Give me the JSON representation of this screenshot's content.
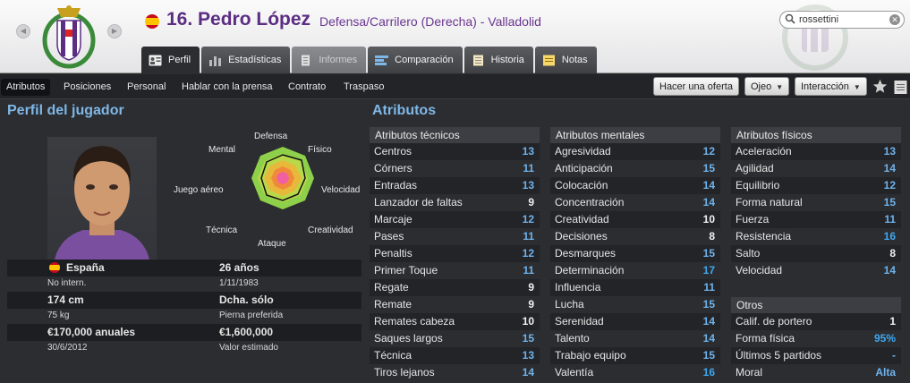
{
  "player": {
    "number_name": "16. Pedro López",
    "role_club": "Defensa/Carrilero (Derecha) - Valladolid"
  },
  "search": {
    "value": "rossettini"
  },
  "tabs": [
    {
      "label": "Perfil",
      "icon": "profile-card-icon",
      "active": true
    },
    {
      "label": "Estadísticas",
      "icon": "bar-chart-icon"
    },
    {
      "label": "Informes",
      "icon": "report-icon",
      "dim": true
    },
    {
      "label": "Comparación",
      "icon": "compare-icon"
    },
    {
      "label": "Historia",
      "icon": "history-icon"
    },
    {
      "label": "Notas",
      "icon": "notes-icon"
    }
  ],
  "subnav": [
    "Atributos",
    "Posiciones",
    "Personal",
    "Hablar con la prensa",
    "Contrato",
    "Traspaso"
  ],
  "actions": {
    "offer": "Hacer una oferta",
    "scout": "Ojeo",
    "interact": "Interacción"
  },
  "profile": {
    "title": "Perfil del jugador",
    "radar_labels": {
      "defensa": "Defensa",
      "fisico": "Físico",
      "velocidad": "Velocidad",
      "creatividad": "Creatividad",
      "ataque": "Ataque",
      "tecnica": "Técnica",
      "aereo": "Juego aéreo",
      "mental": "Mental"
    },
    "nation": "España",
    "intl": "No intern.",
    "age": "26 años",
    "dob": "1/11/1983",
    "height": "174 cm",
    "weight": "75 kg",
    "foot": "Dcha. sólo",
    "foot_label": "Pierna preferida",
    "wage": "€170,000 anuales",
    "contract": "30/6/2012",
    "value": "€1,600,000",
    "value_label": "Valor estimado"
  },
  "attributes": {
    "title": "Atributos",
    "technical": {
      "heading": "Atributos técnicos",
      "rows": [
        [
          "Centros",
          "13"
        ],
        [
          "Córners",
          "11"
        ],
        [
          "Entradas",
          "13"
        ],
        [
          "Lanzador de faltas",
          "9"
        ],
        [
          "Marcaje",
          "12"
        ],
        [
          "Pases",
          "11"
        ],
        [
          "Penaltis",
          "12"
        ],
        [
          "Primer Toque",
          "11"
        ],
        [
          "Regate",
          "9"
        ],
        [
          "Remate",
          "9"
        ],
        [
          "Remates cabeza",
          "10"
        ],
        [
          "Saques largos",
          "15"
        ],
        [
          "Técnica",
          "13"
        ],
        [
          "Tiros lejanos",
          "14"
        ]
      ]
    },
    "mental": {
      "heading": "Atributos mentales",
      "rows": [
        [
          "Agresividad",
          "12"
        ],
        [
          "Anticipación",
          "15"
        ],
        [
          "Colocación",
          "14"
        ],
        [
          "Concentración",
          "14"
        ],
        [
          "Creatividad",
          "10"
        ],
        [
          "Decisiones",
          "8"
        ],
        [
          "Desmarques",
          "15"
        ],
        [
          "Determinación",
          "17"
        ],
        [
          "Influencia",
          "11"
        ],
        [
          "Lucha",
          "15"
        ],
        [
          "Serenidad",
          "14"
        ],
        [
          "Talento",
          "14"
        ],
        [
          "Trabajo equipo",
          "15"
        ],
        [
          "Valentía",
          "16"
        ]
      ]
    },
    "physical": {
      "heading": "Atributos físicos",
      "rows": [
        [
          "Aceleración",
          "13"
        ],
        [
          "Agilidad",
          "14"
        ],
        [
          "Equilibrio",
          "12"
        ],
        [
          "Forma natural",
          "15"
        ],
        [
          "Fuerza",
          "11"
        ],
        [
          "Resistencia",
          "16"
        ],
        [
          "Salto",
          "8"
        ],
        [
          "Velocidad",
          "14"
        ]
      ]
    },
    "other": {
      "heading": "Otros",
      "rows": [
        [
          "Calif. de portero",
          "1"
        ],
        [
          "Forma física",
          "95%"
        ],
        [
          "Últimos 5 partidos",
          "-"
        ],
        [
          "Moral",
          "Alta"
        ]
      ]
    }
  },
  "colors": {
    "title_purple": "#5b2d83",
    "accent_blue": "#7fb7e6",
    "value_blue": "#6fb3ec",
    "bg": "#2b2d31"
  }
}
